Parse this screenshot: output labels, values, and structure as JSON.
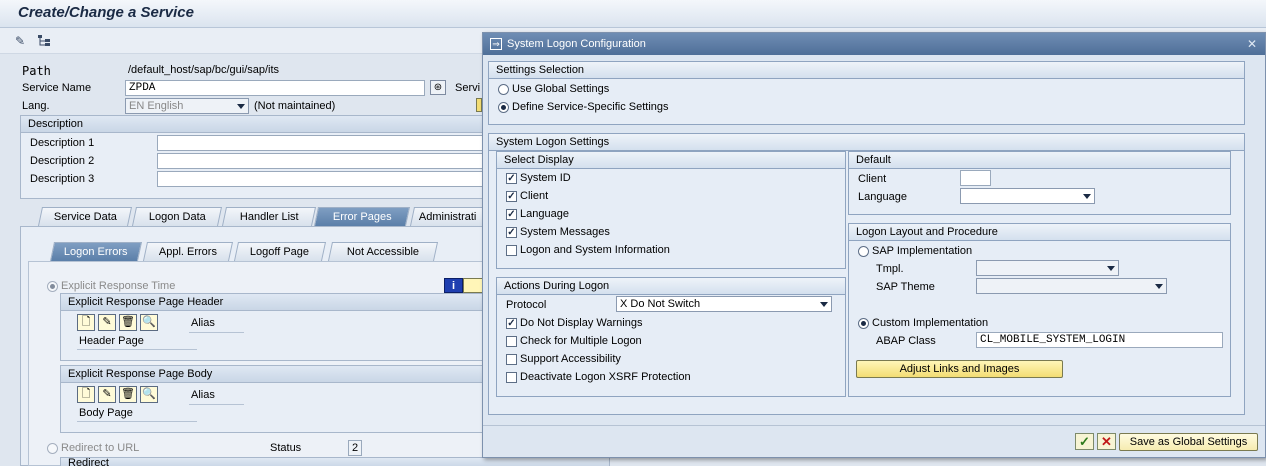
{
  "window": {
    "title": "Create/Change a Service"
  },
  "toolbar": {
    "icons": [
      "edit-icon",
      "hierarchy-icon"
    ]
  },
  "service": {
    "path_label": "Path",
    "path_value": "/default_host/sap/bc/gui/sap/its",
    "name_label": "Service Name",
    "name_value": "ZPDA",
    "service_label_cut": "Servi",
    "lang_label": "Lang.",
    "lang_value": "EN English",
    "lang_note": "(Not maintained)"
  },
  "description": {
    "header": "Description",
    "rows": [
      "Description 1",
      "Description 2",
      "Description 3"
    ]
  },
  "main_tabs": [
    "Service Data",
    "Logon Data",
    "Handler List",
    "Error Pages",
    "Administrati"
  ],
  "sub_tabs": [
    "Logon Errors",
    "Appl. Errors",
    "Logoff Page",
    "Not Accessible"
  ],
  "error_page": {
    "explicit_response_time": "Explicit Response Time",
    "header_group": "Explicit Response Page Header",
    "header_page": "Header Page",
    "body_group": "Explicit Response Page Body",
    "body_page": "Body Page",
    "alias": "Alias",
    "redirect_to_url": "Redirect to URL",
    "status_label": "Status",
    "status_value": "2",
    "redirect_group": "Redirect"
  },
  "dialog": {
    "title": "System Logon Configuration",
    "settings_selection": {
      "header": "Settings Selection",
      "options": [
        "Use Global Settings",
        "Define Service-Specific Settings"
      ],
      "selected": "Define Service-Specific Settings"
    },
    "system_logon_settings": {
      "header": "System Logon Settings",
      "select_display": {
        "header": "Select Display",
        "items": [
          {
            "label": "System ID",
            "checked": true
          },
          {
            "label": "Client",
            "checked": true
          },
          {
            "label": "Language",
            "checked": true
          },
          {
            "label": "System Messages",
            "checked": true
          },
          {
            "label": "Logon and System Information",
            "checked": false
          }
        ]
      },
      "default": {
        "header": "Default",
        "client_label": "Client",
        "client_value": "",
        "language_label": "Language",
        "language_value": ""
      },
      "actions": {
        "header": "Actions During Logon",
        "protocol_label": "Protocol",
        "protocol_value": "X Do Not Switch",
        "items": [
          {
            "label": "Do Not Display Warnings",
            "checked": true
          },
          {
            "label": "Check for Multiple Logon",
            "checked": false
          },
          {
            "label": "Support Accessibility",
            "checked": false
          },
          {
            "label": "Deactivate Logon XSRF Protection",
            "checked": false
          }
        ]
      },
      "layout": {
        "header": "Logon Layout and Procedure",
        "sap_impl": "SAP Implementation",
        "tmpl_label": "Tmpl.",
        "tmpl_value": "",
        "theme_label": "SAP Theme",
        "theme_value": "",
        "custom_impl": "Custom Implementation",
        "abap_label": "ABAP Class",
        "abap_value": "CL_MOBILE_SYSTEM_LOGIN",
        "adjust_button": "Adjust Links and Images",
        "selected": "Custom Implementation"
      }
    },
    "footer": {
      "ok_icon": "checkmark-icon",
      "cancel_icon": "cancel-icon",
      "save_global": "Save as Global Settings"
    }
  },
  "colors": {
    "accent": "#4f6f98",
    "button": "#f3dd74",
    "active_tab": "#5b7fa9"
  }
}
